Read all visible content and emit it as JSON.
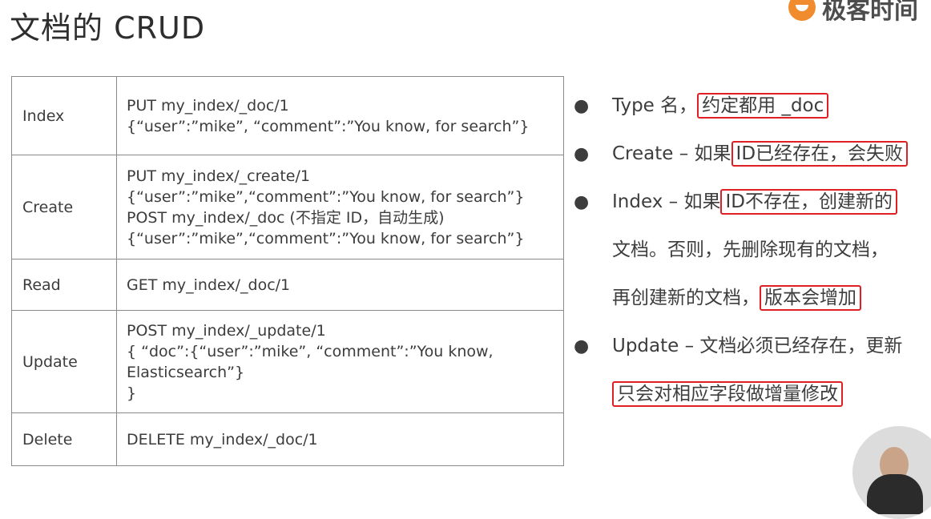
{
  "title": "文档的 CRUD",
  "logo": {
    "text": "极客时间"
  },
  "table": {
    "rows": [
      {
        "op": "Index",
        "lines": [
          "PUT my_index/_doc/1",
          "{“user”:”mike”, “comment”:”You know, for search”}"
        ]
      },
      {
        "op": "Create",
        "lines": [
          "PUT my_index/_create/1",
          "{“user”:”mike”,“comment”:”You know, for search”}",
          "POST my_index/_doc (不指定 ID，自动生成)",
          "{“user”:”mike”,“comment”:”You know, for search”}"
        ]
      },
      {
        "op": "Read",
        "lines": [
          "GET my_index/_doc/1"
        ]
      },
      {
        "op": "Update",
        "lines": [
          "POST my_index/_update/1",
          "{   “doc”:{“user”:”mike”, “comment”:”You know,",
          "Elasticsearch”}",
          "}"
        ]
      },
      {
        "op": "Delete",
        "lines": [
          "DELETE my_index/_doc/1"
        ]
      }
    ]
  },
  "bullets": {
    "b1": {
      "text": "Type 名，",
      "hl": "约定都用 _doc"
    },
    "b2": {
      "text": "Create – 如果",
      "hl": "ID已经存在，会失败"
    },
    "b3": {
      "text": "Index – 如果",
      "hl": "ID不存在，创建新的",
      "line2": "文档。否则，先删除现有的文档，",
      "line3": "再创建新的文档，",
      "line3_hl": "版本会增加"
    },
    "b4": {
      "text": "Update – 文档必须已经存在，更新",
      "line2_hl": "只会对相应字段做增量修改"
    }
  },
  "bullet_glyph": "●",
  "colors": {
    "highlight_box": "#e01f24",
    "logo_orange": "#f08c2d"
  }
}
